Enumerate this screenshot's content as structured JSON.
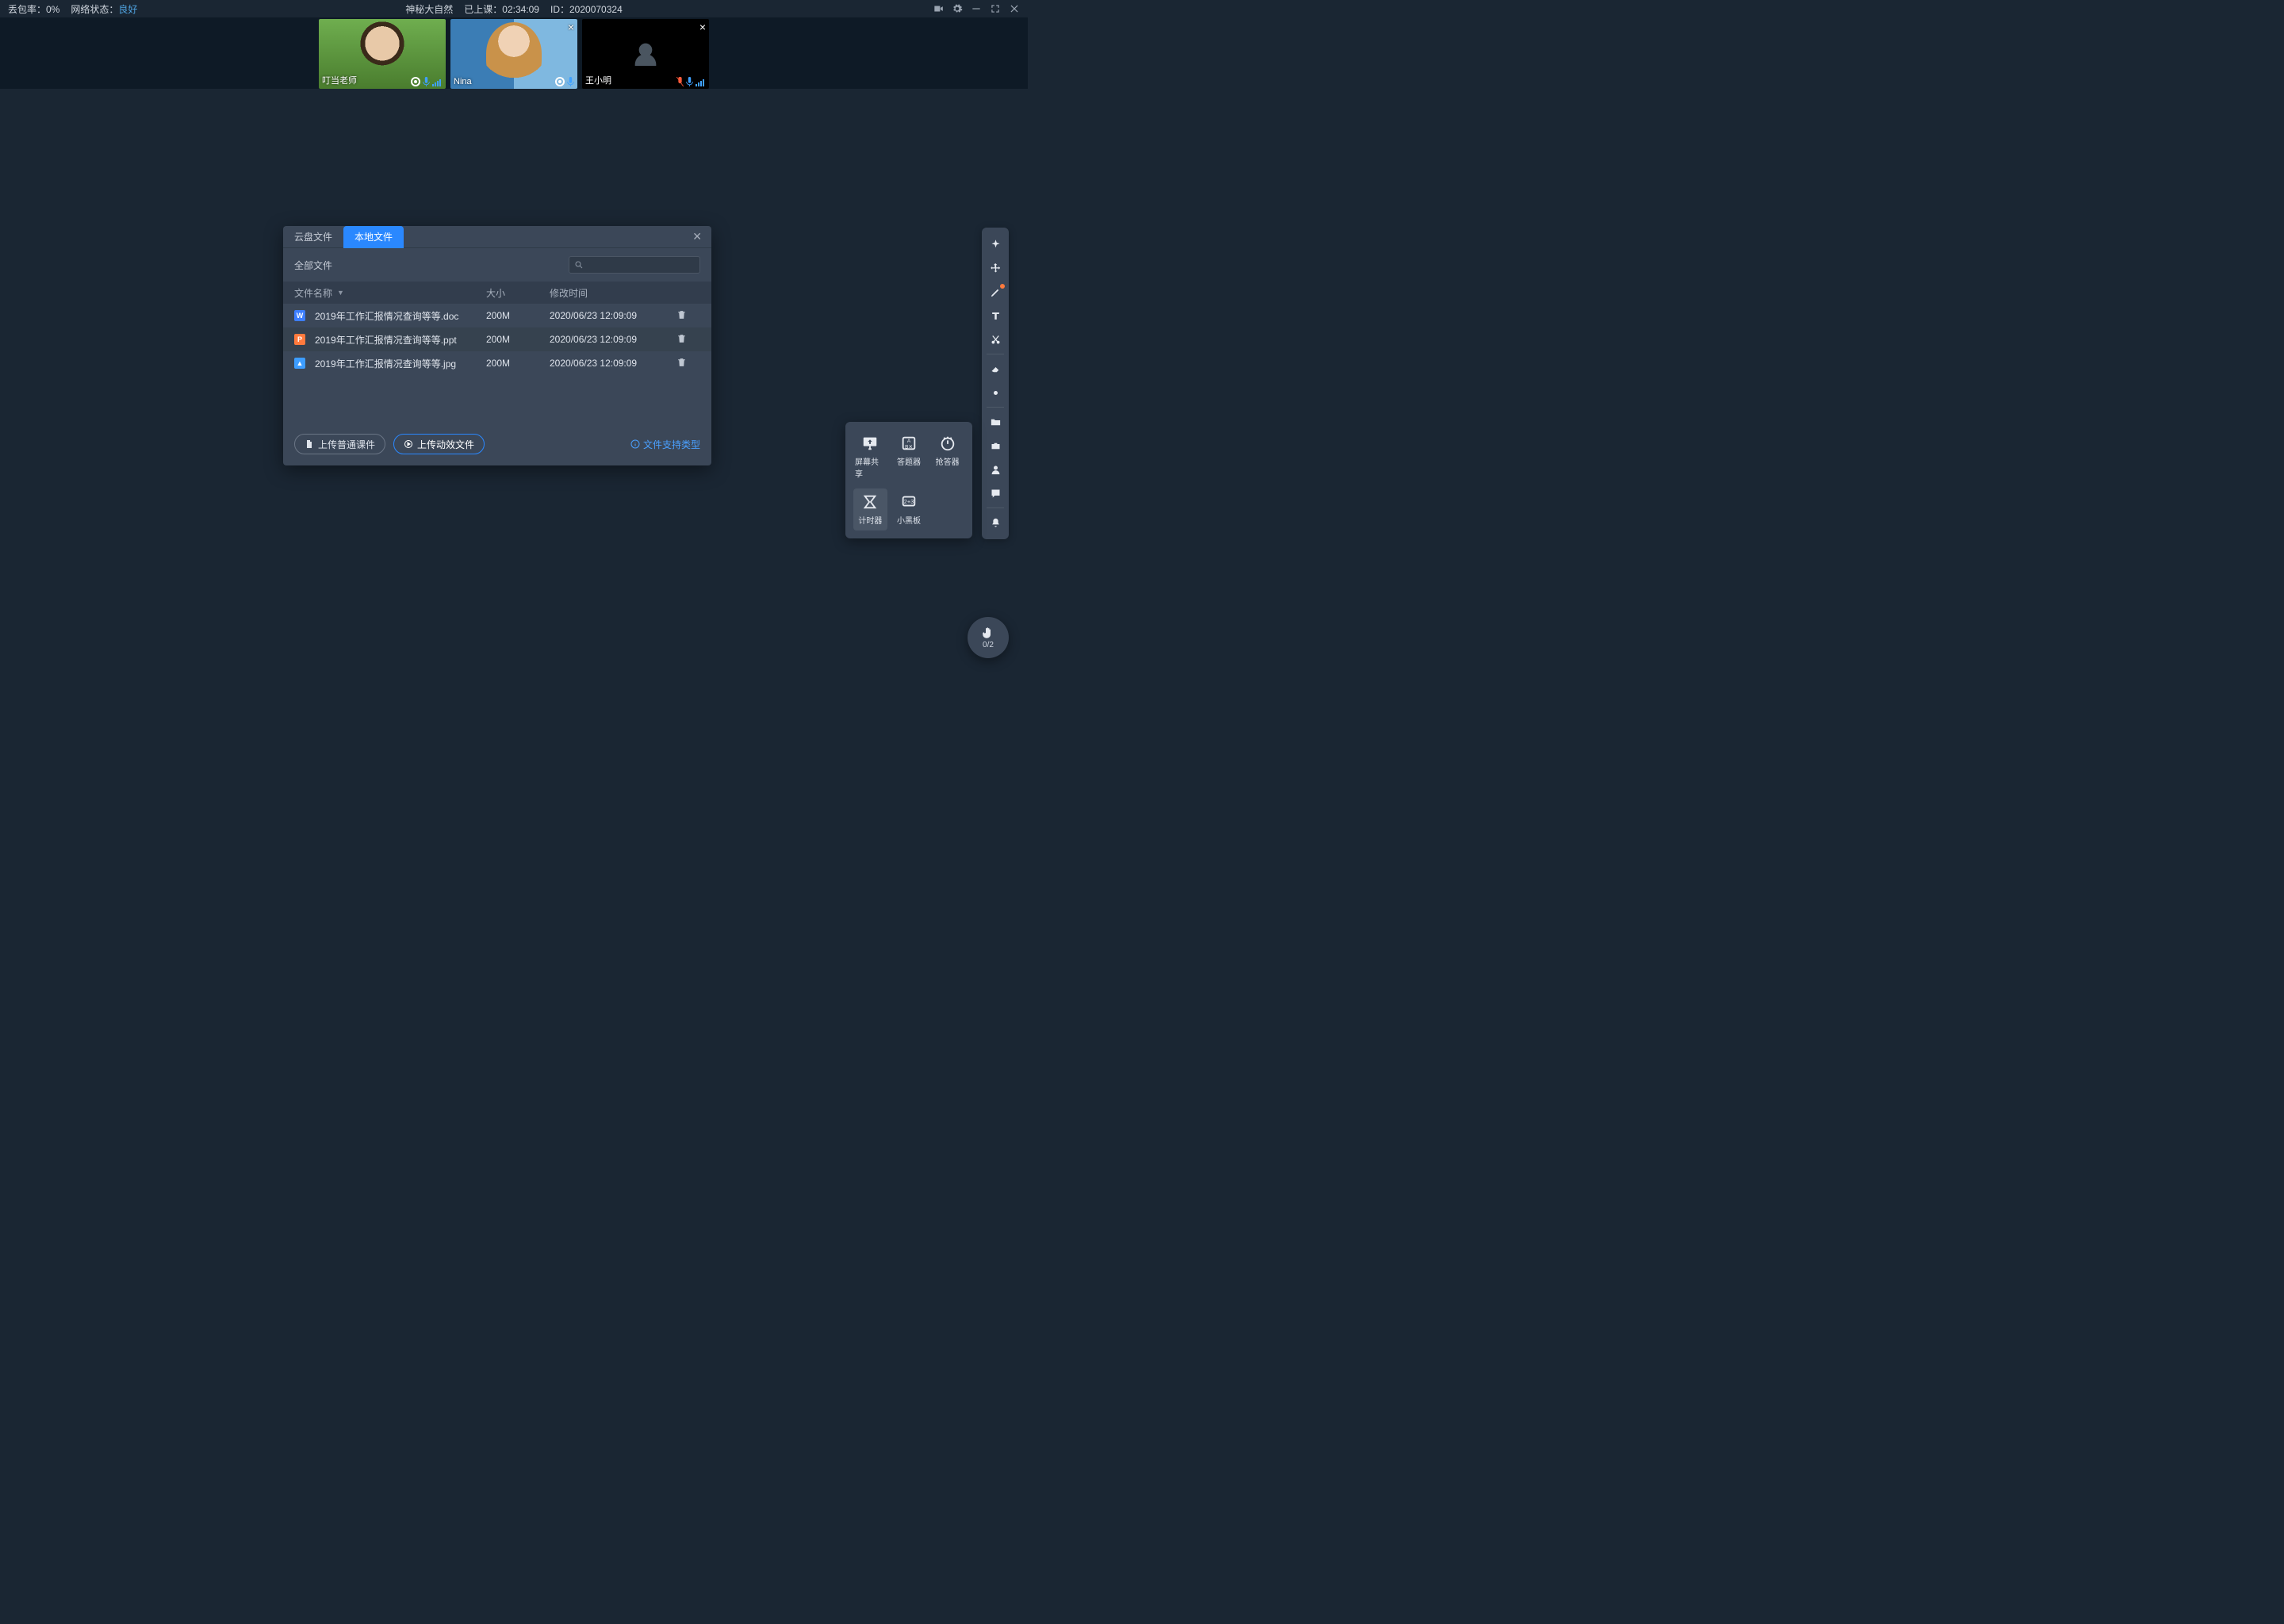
{
  "top": {
    "packet_loss_label": "丢包率：0%",
    "net_label": "网络状态：",
    "net_value": "良好",
    "title": "神秘大自然",
    "elapsed_label": "已上课：",
    "elapsed_value": "02:34:09",
    "id_label": "ID：",
    "id_value": "2020070324"
  },
  "videos": [
    {
      "name": "叮当老师",
      "camera_on": true,
      "muted": false,
      "closable": false
    },
    {
      "name": "Nina",
      "camera_on": true,
      "muted": false,
      "closable": true
    },
    {
      "name": "王小明",
      "camera_on": false,
      "muted": true,
      "closable": true
    }
  ],
  "dialog": {
    "tab_cloud": "云盘文件",
    "tab_local": "本地文件",
    "active_tab": "local",
    "filter_all": "全部文件",
    "col_name": "文件名称",
    "col_size": "大小",
    "col_time": "修改时间",
    "rows": [
      {
        "type": "doc",
        "type_label": "W",
        "name": "2019年工作汇报情况查询等等.doc",
        "size": "200M",
        "time": "2020/06/23 12:09:09"
      },
      {
        "type": "ppt",
        "type_label": "P",
        "name": "2019年工作汇报情况查询等等.ppt",
        "size": "200M",
        "time": "2020/06/23 12:09:09"
      },
      {
        "type": "jpg",
        "type_label": "▲",
        "name": "2019年工作汇报情况查询等等.jpg",
        "size": "200M",
        "time": "2020/06/23 12:09:09"
      }
    ],
    "btn_upload_normal": "上传普通课件",
    "btn_upload_anim": "上传动效文件",
    "link_types": "文件支持类型"
  },
  "tools": {
    "screen_share": "屏幕共享",
    "quiz": "答题器",
    "buzzer": "抢答器",
    "timer": "计时器",
    "board": "小黑板"
  },
  "hand": {
    "count": "0/2"
  }
}
